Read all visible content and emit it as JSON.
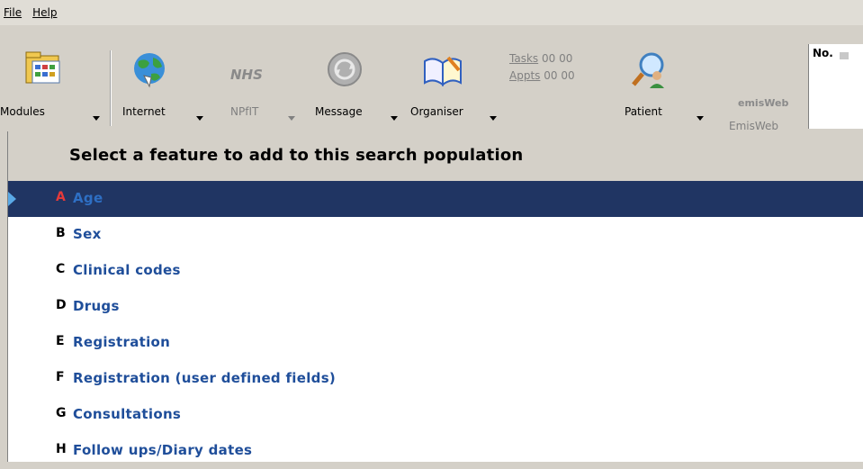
{
  "menu": {
    "file": "File",
    "help": "Help"
  },
  "toolbar": {
    "modules": "Modules",
    "internet": "Internet",
    "npfit": "NPfIT",
    "nhs": "NHS",
    "message": "Message",
    "organiser": "Organiser",
    "tasks": "Tasks",
    "tasks_value": "00 00",
    "appts": "Appts",
    "appts_value": "00 00",
    "patient": "Patient",
    "emisweb": "EmisWeb",
    "emis_logo": "emisWeb"
  },
  "patient_panel": {
    "no_label": "No."
  },
  "header": {
    "title": "Select a feature to add to this search population"
  },
  "features": [
    {
      "letter": "A",
      "label": "Age",
      "selected": true
    },
    {
      "letter": "B",
      "label": "Sex"
    },
    {
      "letter": "C",
      "label": "Clinical codes"
    },
    {
      "letter": "D",
      "label": "Drugs"
    },
    {
      "letter": "E",
      "label": "Registration"
    },
    {
      "letter": "F",
      "label": "Registration (user defined fields)"
    },
    {
      "letter": "G",
      "label": "Consultations"
    },
    {
      "letter": "H",
      "label": "Follow ups/Diary dates"
    }
  ]
}
